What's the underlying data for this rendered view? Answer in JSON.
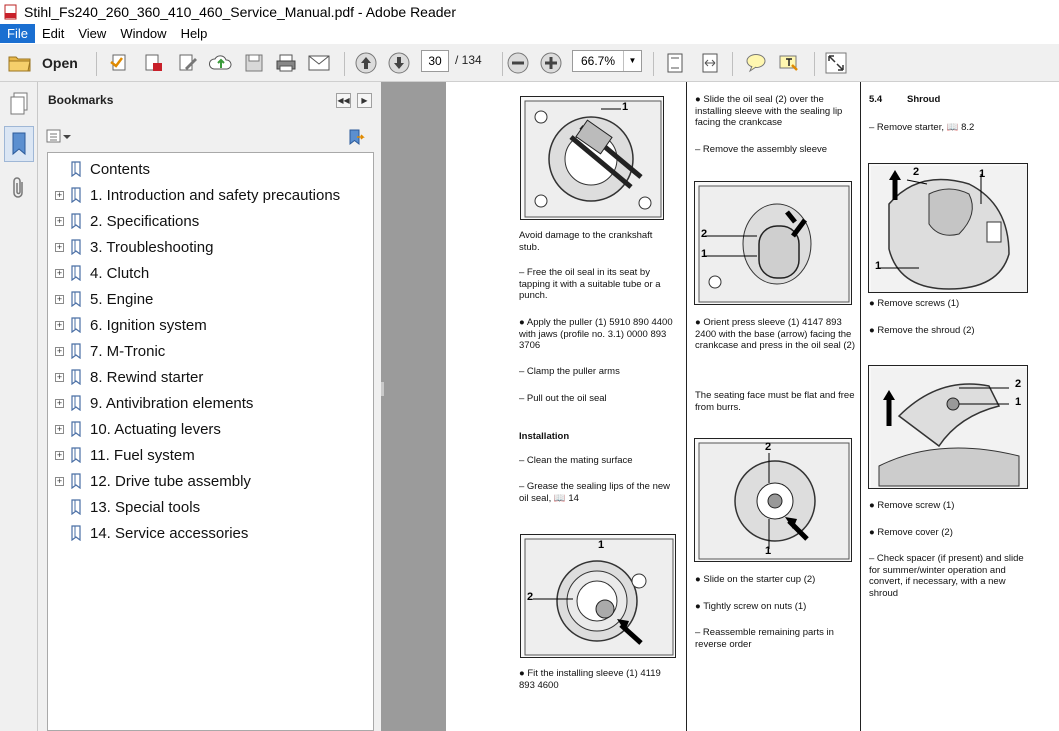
{
  "window": {
    "title": "Stihl_Fs240_260_360_410_460_Service_Manual.pdf - Adobe Reader"
  },
  "menu": {
    "file": "File",
    "edit": "Edit",
    "view": "View",
    "window": "Window",
    "help": "Help"
  },
  "toolbar": {
    "open_label": "Open",
    "page_current": "30",
    "page_total": "/ 134",
    "zoom": "66.7%"
  },
  "bookmarks": {
    "header": "Bookmarks",
    "items": [
      {
        "label": "Contents",
        "expandable": false
      },
      {
        "label": "1. Introduction and safety precautions",
        "expandable": true
      },
      {
        "label": "2. Specifications",
        "expandable": true
      },
      {
        "label": "3. Troubleshooting",
        "expandable": true
      },
      {
        "label": "4. Clutch",
        "expandable": true
      },
      {
        "label": "5. Engine",
        "expandable": true
      },
      {
        "label": "6. Ignition system",
        "expandable": true
      },
      {
        "label": "7. M-Tronic",
        "expandable": true
      },
      {
        "label": "8. Rewind starter",
        "expandable": true
      },
      {
        "label": "9. Antivibration elements",
        "expandable": true
      },
      {
        "label": "10. Actuating levers",
        "expandable": true
      },
      {
        "label": "11. Fuel system",
        "expandable": true
      },
      {
        "label": "12. Drive tube assembly",
        "expandable": true
      },
      {
        "label": "13. Special tools",
        "expandable": false
      },
      {
        "label": "14. Service accessories",
        "expandable": false
      }
    ]
  },
  "document": {
    "col1": {
      "t1": "Avoid damage to the crankshaft stub.",
      "t2": "–  Free the oil seal in its seat by tapping it with a suitable tube or a punch.",
      "t3": "●  Apply the puller (1) 5910 890 4400 with jaws (profile no. 3.1) 0000 893 3706",
      "t4": "–  Clamp the puller arms",
      "t5": "–  Pull out the oil seal",
      "h1": "Installation",
      "t6": "–  Clean the mating surface",
      "t7": "–  Grease the sealing lips of the new oil seal, 📖 14",
      "t8": "●  Fit the installing sleeve (1) 4119 893 4600"
    },
    "col2": {
      "t1": "●  Slide the oil seal (2) over the installing sleeve with the sealing lip facing the crankcase",
      "t2": "–  Remove the assembly sleeve",
      "t3": "●  Orient press sleeve (1) 4147 893 2400 with the base (arrow) facing the crankcase and press in the oil seal (2)",
      "t4": "The seating face must be flat and free from burrs.",
      "t5": "●  Slide on the starter cup (2)",
      "t6": "●  Tightly screw on nuts (1)",
      "t7": "–  Reassemble remaining parts in reverse order"
    },
    "col3": {
      "sec_num": "5.4",
      "sec_title": "Shroud",
      "t1": "–  Remove starter, 📖 8.2",
      "t2": "●  Remove screws (1)",
      "t3": "●  Remove the shroud (2)",
      "t4": "●  Remove screw (1)",
      "t5": "●  Remove cover (2)",
      "t6": "–  Check spacer (if present) and slide for summer/winter operation and convert, if necessary, with a new shroud"
    },
    "figures": {
      "f1": {
        "n1": "1"
      },
      "f2": {
        "n1": "1",
        "n2": "2"
      },
      "f3": {
        "n1": "1",
        "n2": "2"
      },
      "f4": {
        "n1": "1",
        "n2": "2"
      },
      "f5": {
        "n1": "1",
        "n2": "1",
        "n3": "2"
      },
      "f6": {
        "n1": "2",
        "n2": "1"
      }
    }
  }
}
